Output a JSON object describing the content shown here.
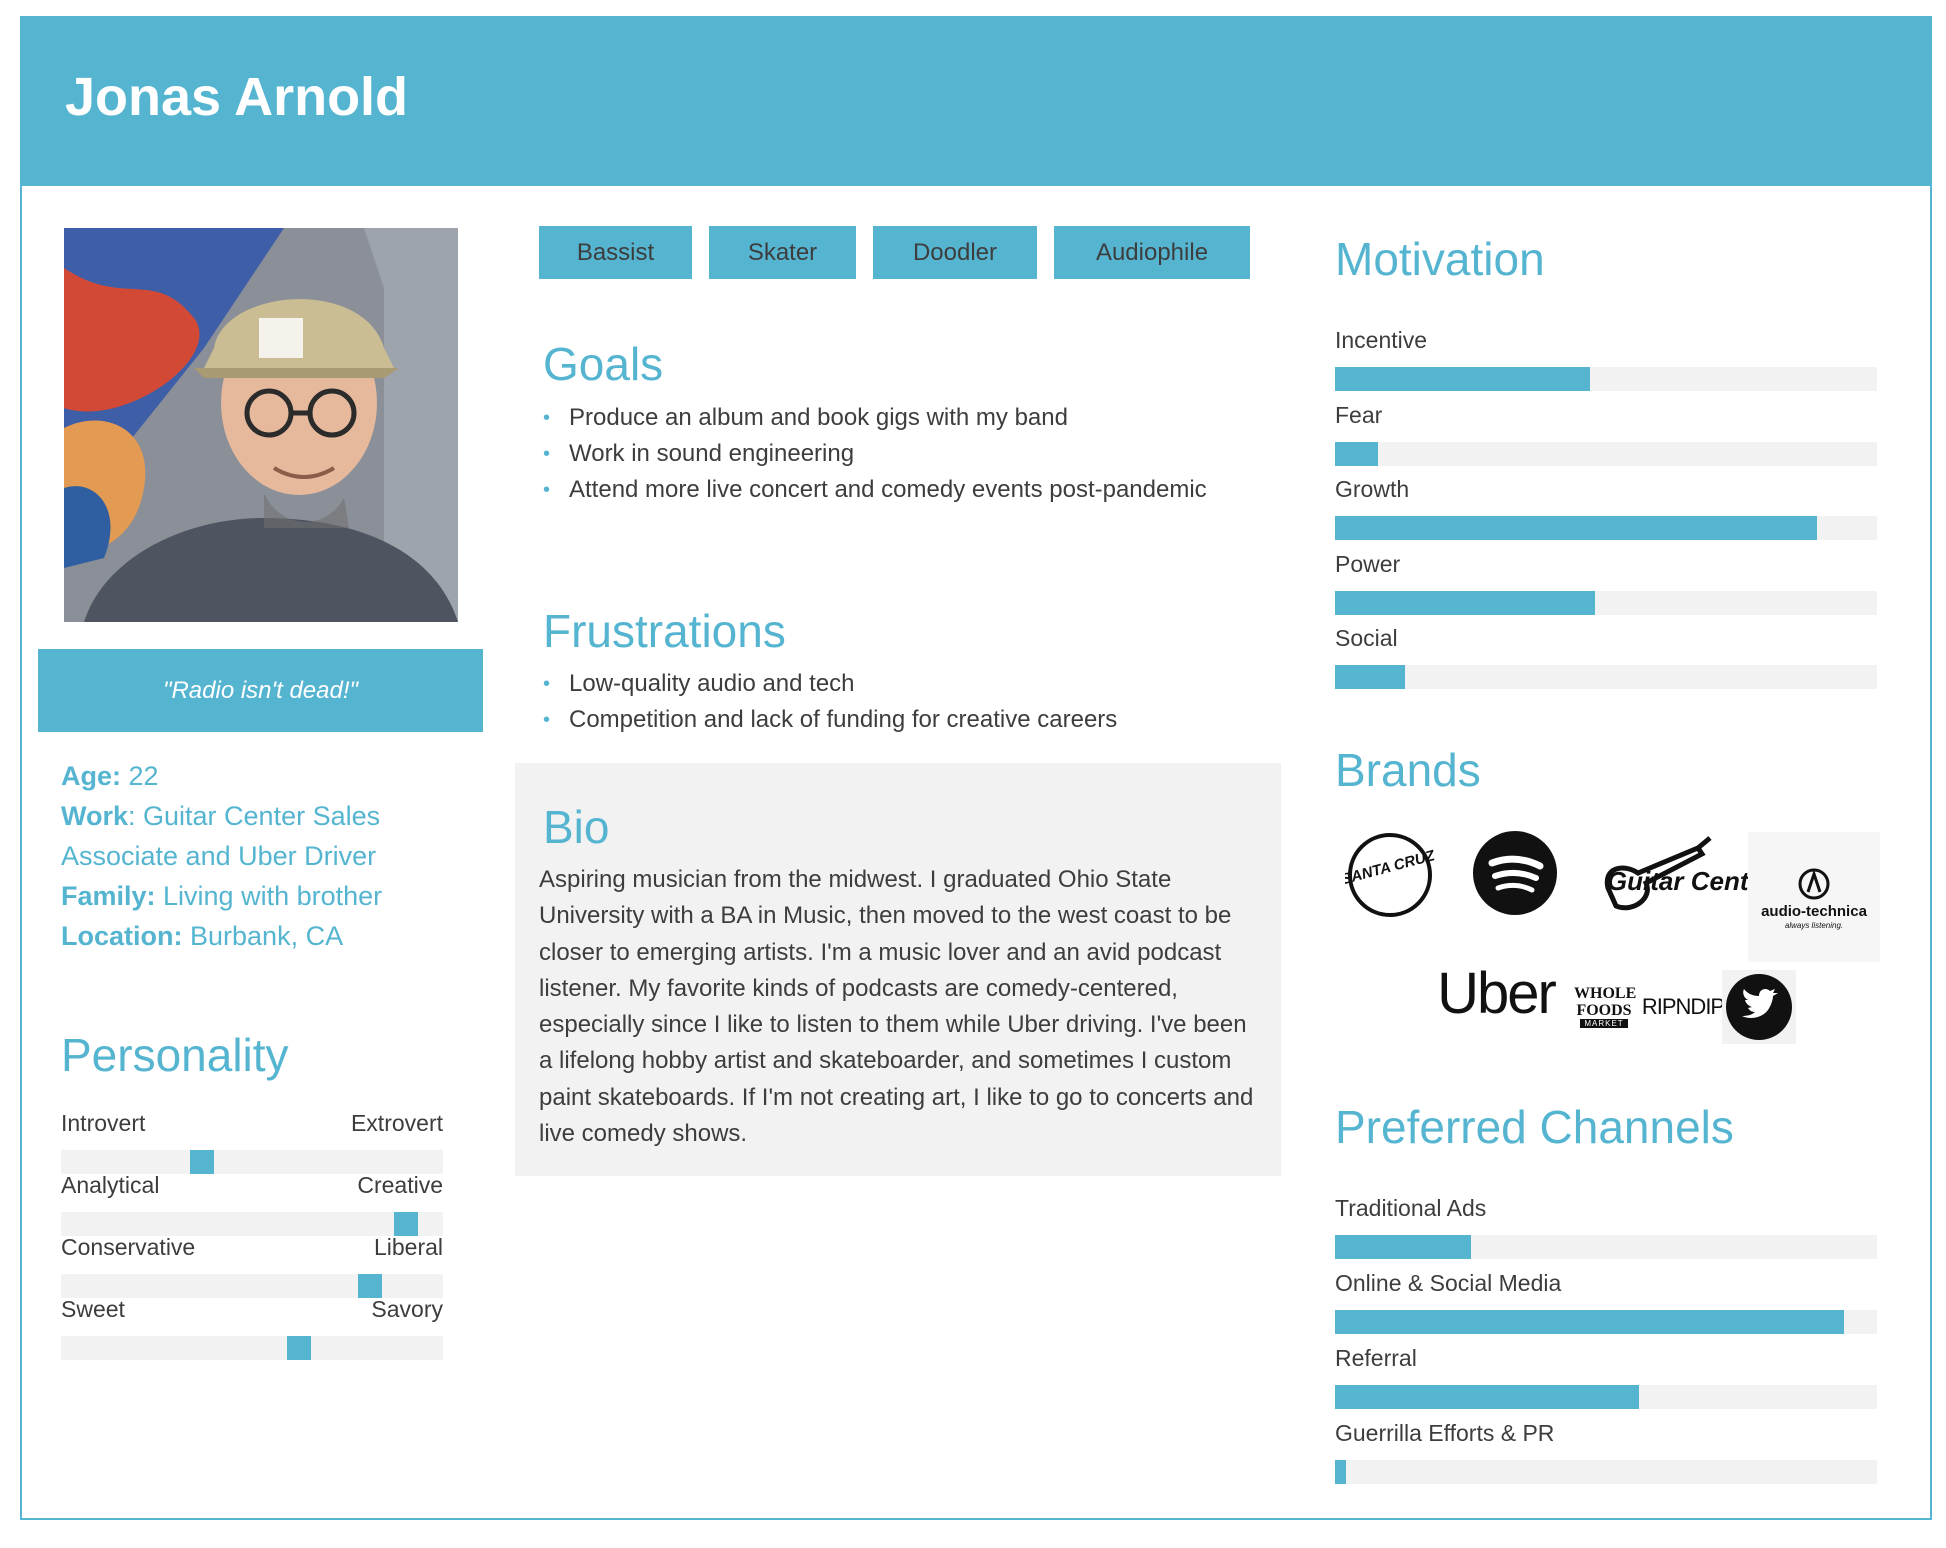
{
  "persona": {
    "name": "Jonas Arnold",
    "quote": "\"Radio isn't dead!\"",
    "facts": [
      {
        "key": "Age:",
        "value": " 22"
      },
      {
        "key": "Work",
        "value": ": Guitar Center Sales Associate and Uber Driver"
      },
      {
        "key": "Family:",
        "value": " Living with brother"
      },
      {
        "key": "Location:",
        "value": " Burbank, CA"
      }
    ]
  },
  "tags": [
    "Bassist",
    "Skater",
    "Doodler",
    "Audiophile"
  ],
  "goals": {
    "title": "Goals",
    "items": [
      "Produce an album and book gigs with my band",
      "Work in sound engineering",
      "Attend more live concert and comedy events post-pandemic"
    ]
  },
  "frustrations": {
    "title": "Frustrations",
    "items": [
      "Low-quality audio and tech",
      "Competition and lack of funding for creative careers"
    ]
  },
  "bio": {
    "title": "Bio",
    "text": "Aspiring musician from the midwest. I graduated Ohio State University with a BA in Music, then moved to the west coast to be closer to emerging artists. I'm a music lover and an avid podcast listener. My favorite kinds of podcasts are comedy-centered, especially since I like to listen to them while Uber driving. I've been a lifelong hobby artist and skateboarder, and sometimes I custom paint skateboards. If I'm not creating art, I like to go to concerts and live comedy shows."
  },
  "personality": {
    "title": "Personality",
    "scales": [
      {
        "left": "Introvert",
        "right": "Extrovert",
        "value": 0.36
      },
      {
        "left": "Analytical",
        "right": "Creative",
        "value": 0.93
      },
      {
        "left": "Conservative",
        "right": "Liberal",
        "value": 0.83
      },
      {
        "left": "Sweet",
        "right": "Savory",
        "value": 0.63
      }
    ]
  },
  "motivation": {
    "title": "Motivation",
    "items": [
      {
        "label": "Incentive",
        "value": 0.47
      },
      {
        "label": "Fear",
        "value": 0.08
      },
      {
        "label": "Growth",
        "value": 0.89
      },
      {
        "label": "Power",
        "value": 0.48
      },
      {
        "label": "Social",
        "value": 0.13
      }
    ]
  },
  "brands": {
    "title": "Brands",
    "logos": [
      {
        "name": "Santa Cruz",
        "text": "SANTA CRUZ"
      },
      {
        "name": "Spotify",
        "text": ""
      },
      {
        "name": "Guitar Center",
        "text": "Guitar Center"
      },
      {
        "name": "Audio-Technica",
        "text": "audio-technica",
        "subtext": "always listening."
      },
      {
        "name": "Uber",
        "text": "Uber"
      },
      {
        "name": "Whole Foods",
        "text": "WHOLE FOODS",
        "subtext": "MARKET"
      },
      {
        "name": "RipNDip",
        "text": "RIPNDIP"
      },
      {
        "name": "Twitter",
        "text": ""
      }
    ]
  },
  "channels": {
    "title": "Preferred Channels",
    "items": [
      {
        "label": "Traditional Ads",
        "value": 0.25
      },
      {
        "label": "Online & Social Media",
        "value": 0.94
      },
      {
        "label": "Referral",
        "value": 0.56
      },
      {
        "label": "Guerrilla Efforts & PR",
        "value": 0.02
      }
    ]
  },
  "colors": {
    "accent": "#55b5d1",
    "track": "#f2f2f2",
    "text": "#3d3d3d"
  }
}
